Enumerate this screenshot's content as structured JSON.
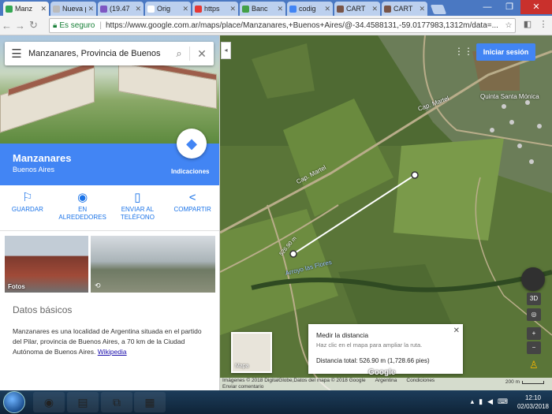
{
  "browser": {
    "tabs": [
      {
        "title": "Manz",
        "color": "#34a853",
        "active": true
      },
      {
        "title": "Nueva pe",
        "color": "#bbbbbb",
        "active": false
      },
      {
        "title": "(19.47",
        "color": "#7e57c2",
        "active": false
      },
      {
        "title": "Orig",
        "color": "#ffffff",
        "active": false
      },
      {
        "title": "https",
        "color": "#e53935",
        "active": false
      },
      {
        "title": "Banc",
        "color": "#43a047",
        "active": false
      },
      {
        "title": "codig",
        "color": "#4285f4",
        "active": false
      },
      {
        "title": "CART",
        "color": "#795548",
        "active": false
      },
      {
        "title": "CART",
        "color": "#795548",
        "active": false
      }
    ],
    "secure_label": "Es seguro",
    "url": "https://www.google.com.ar/maps/place/Manzanares,+Buenos+Aires/@-34.4588131,-59.0177983,1312m/data=..."
  },
  "panel": {
    "search_value": "Manzanares, Provincia de Buenos",
    "place_name": "Manzanares",
    "place_sub": "Buenos Aires",
    "directions_label": "Indicaciones",
    "actions": [
      {
        "label": "GUARDAR",
        "icon": "bookmark-icon",
        "glyph": "⚐"
      },
      {
        "label": "EN ALREDEDORES",
        "icon": "nearby-icon",
        "glyph": "◉"
      },
      {
        "label": "ENVIAR AL TELÉFONO",
        "icon": "send-to-phone-icon",
        "glyph": "▯"
      },
      {
        "label": "COMPARTIR",
        "icon": "share-icon",
        "glyph": "<"
      }
    ],
    "photos_label": "Fotos",
    "basics_title": "Datos básicos",
    "description": "Manzanares es una localidad de Argentina situada en el partido del Pilar, provincia de Buenos Aires, a 70 km de la Ciudad Autónoma de Buenos Aires.",
    "wiki_link": "Wikipedia"
  },
  "map": {
    "login_label": "Iniciar sesión",
    "place_labels": {
      "quinta": "Quinta Santa Mónica",
      "cap_martel_1": "Cap. Martel",
      "cap_martel_2": "Cap. Martel",
      "arroyo": "Arroyo las Flores",
      "distance_tag": "526.90 m"
    },
    "measure": {
      "title": "Medir la distancia",
      "hint": "Haz clic en el mapa para ampliar la ruta.",
      "total": "Distancia total: 526.90 m (1,728.66 pies)"
    },
    "thumb_label": "Mapa",
    "controls": {
      "tilt": "3D",
      "zoom_in": "+",
      "zoom_out": "−"
    },
    "footer": {
      "imagery": "Imágenes © 2018 DigitalGlobe,Datos del mapa © 2018 Google",
      "country": "Argentina",
      "terms": "Condiciones",
      "feedback": "Enviar comentario",
      "scale": "200 m"
    },
    "google_logo": "Google"
  },
  "taskbar": {
    "time": "12:10",
    "date": "02/03/2018"
  }
}
